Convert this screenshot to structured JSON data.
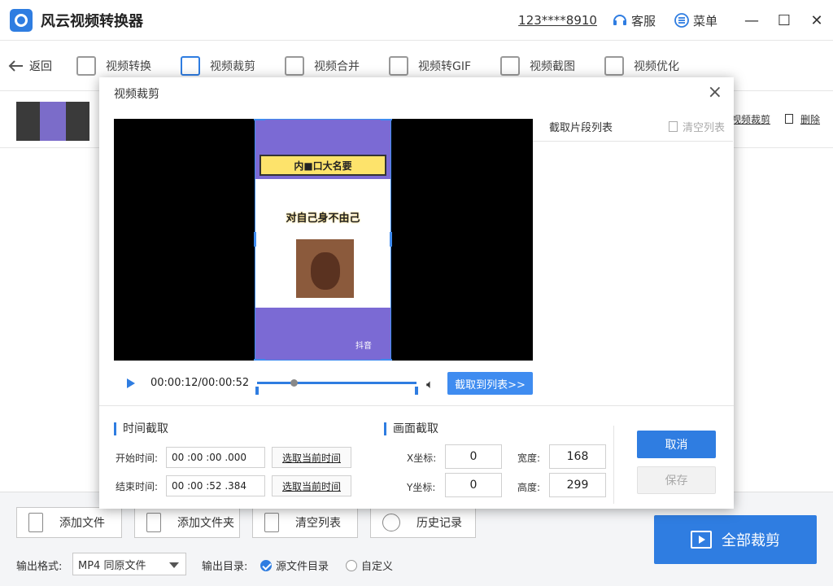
{
  "app": {
    "title": "风云视频转换器",
    "account": "123****8910",
    "support_label": "客服",
    "menu_label": "菜单"
  },
  "toolbar": {
    "back_label": "返回",
    "tools": [
      {
        "label": "视频转换"
      },
      {
        "label": "视频裁剪"
      },
      {
        "label": "视频合并"
      },
      {
        "label": "视频转GIF"
      },
      {
        "label": "视频截图"
      },
      {
        "label": "视频优化"
      }
    ]
  },
  "file_row": {
    "crop_link": "视频裁剪",
    "delete_link": "删除"
  },
  "dialog": {
    "title": "视频裁剪",
    "list_title": "截取片段列表",
    "clear_list": "清空列表",
    "time_display": "00:00:12/00:00:52",
    "progress": 0.23,
    "extract_button": "截取到列表>>",
    "video": {
      "banner": "内■口大名要",
      "caption": "对自己身不由己",
      "watermark": "抖音"
    },
    "time_section": {
      "title": "时间截取",
      "start_label": "开始时间:",
      "start_value": "00  :00  :00  .000",
      "end_label": "结束时间:",
      "end_value": "00  :00  :52  .384",
      "grab_current": "选取当前时间"
    },
    "frame_section": {
      "title": "画面截取",
      "x_label": "X坐标:",
      "x_value": "0",
      "y_label": "Y坐标:",
      "y_value": "0",
      "w_label": "宽度:",
      "w_value": "168",
      "h_label": "高度:",
      "h_value": "299"
    },
    "cancel": "取消",
    "save": "保存"
  },
  "bottom": {
    "add_file": "添加文件",
    "add_folder": "添加文件夹",
    "clear_list": "清空列表",
    "history": "历史记录",
    "format_label": "输出格式:",
    "format_value": "MP4 同原文件",
    "output_label": "输出目录:",
    "radio_source": "源文件目录",
    "radio_custom": "自定义",
    "crop_all": "全部裁剪"
  },
  "colors": {
    "accent": "#2f7de1",
    "video_purple": "#7b6ad4",
    "banner_yellow": "#fde36b"
  }
}
